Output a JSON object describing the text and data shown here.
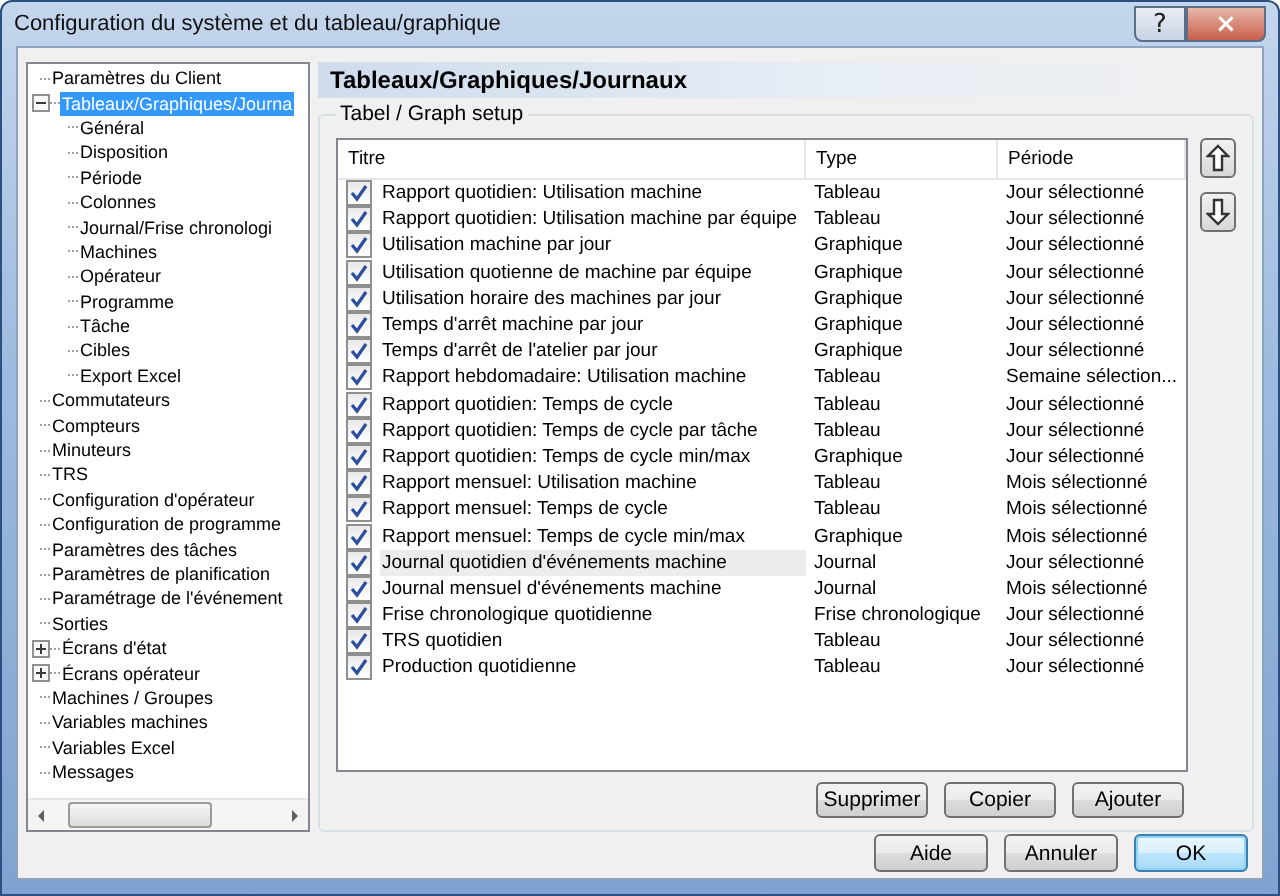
{
  "window": {
    "title": "Configuration du système et du tableau/graphique",
    "help_button": "?",
    "close_button": "×"
  },
  "tree": [
    {
      "label": "Paramètres du Client",
      "selected": false
    },
    {
      "label": "Tableaux/Graphiques/Journa",
      "selected": true,
      "expanded": true,
      "children": [
        {
          "label": "Général",
          "selected": false
        },
        {
          "label": "Disposition",
          "selected": false
        },
        {
          "label": "Période",
          "selected": false
        },
        {
          "label": "Colonnes",
          "selected": false
        },
        {
          "label": "Journal/Frise chronologi",
          "selected": false
        },
        {
          "label": "Machines",
          "selected": false
        },
        {
          "label": "Opérateur",
          "selected": false
        },
        {
          "label": "Programme",
          "selected": false
        },
        {
          "label": "Tâche",
          "selected": false
        },
        {
          "label": "Cibles",
          "selected": false
        },
        {
          "label": "Export Excel",
          "selected": false
        }
      ]
    },
    {
      "label": "Commutateurs",
      "selected": false
    },
    {
      "label": "Compteurs",
      "selected": false
    },
    {
      "label": "Minuteurs",
      "selected": false
    },
    {
      "label": "TRS",
      "selected": false
    },
    {
      "label": "Configuration d'opérateur",
      "selected": false
    },
    {
      "label": "Configuration de programme",
      "selected": false
    },
    {
      "label": "Paramètres des tâches",
      "selected": false
    },
    {
      "label": "Paramètres de planification",
      "selected": false
    },
    {
      "label": "Paramétrage de l'événement",
      "selected": false
    },
    {
      "label": "Sorties",
      "selected": false
    },
    {
      "label": "Écrans d'état",
      "selected": false,
      "expanded": false
    },
    {
      "label": "Écrans opérateur",
      "selected": false,
      "expanded": false
    },
    {
      "label": "Machines / Groupes",
      "selected": false
    },
    {
      "label": "Variables machines",
      "selected": false
    },
    {
      "label": "Variables Excel",
      "selected": false
    },
    {
      "label": "Messages",
      "selected": false
    }
  ],
  "panel": {
    "title": "Tableaux/Graphiques/Journaux",
    "group_label": "Tabel / Graph setup"
  },
  "table": {
    "columns": [
      "Titre",
      "Type",
      "Période"
    ],
    "rows": [
      {
        "title": "Rapport quotidien: Utilisation machine",
        "type": "Tableau",
        "period": "Jour sélectionné",
        "checked": true,
        "selected": false
      },
      {
        "title": "Rapport quotidien: Utilisation machine par équipe",
        "type": "Tableau",
        "period": "Jour sélectionné",
        "checked": true,
        "selected": false
      },
      {
        "title": "Utilisation machine par jour",
        "type": "Graphique",
        "period": "Jour sélectionné",
        "checked": true,
        "selected": false
      },
      {
        "title": "Utilisation quotienne de machine par équipe",
        "type": "Graphique",
        "period": "Jour sélectionné",
        "checked": true,
        "selected": false
      },
      {
        "title": "Utilisation horaire des machines par jour",
        "type": "Graphique",
        "period": "Jour sélectionné",
        "checked": true,
        "selected": false
      },
      {
        "title": "Temps d'arrêt machine par jour",
        "type": "Graphique",
        "period": "Jour sélectionné",
        "checked": true,
        "selected": false
      },
      {
        "title": "Temps d'arrêt de l'atelier par jour",
        "type": "Graphique",
        "period": "Jour sélectionné",
        "checked": true,
        "selected": false
      },
      {
        "title": "Rapport hebdomadaire: Utilisation machine",
        "type": "Tableau",
        "period": "Semaine sélection...",
        "checked": true,
        "selected": false
      },
      {
        "title": "Rapport quotidien: Temps de cycle",
        "type": "Tableau",
        "period": "Jour sélectionné",
        "checked": true,
        "selected": false
      },
      {
        "title": "Rapport quotidien: Temps de cycle par tâche",
        "type": "Tableau",
        "period": "Jour sélectionné",
        "checked": true,
        "selected": false
      },
      {
        "title": "Rapport quotidien: Temps de cycle min/max",
        "type": "Graphique",
        "period": "Jour sélectionné",
        "checked": true,
        "selected": false
      },
      {
        "title": "Rapport mensuel: Utilisation machine",
        "type": "Tableau",
        "period": "Mois sélectionné",
        "checked": true,
        "selected": false
      },
      {
        "title": "Rapport mensuel: Temps de cycle",
        "type": "Tableau",
        "period": "Mois sélectionné",
        "checked": true,
        "selected": false
      },
      {
        "title": "Rapport mensuel: Temps de cycle min/max",
        "type": "Graphique",
        "period": "Mois sélectionné",
        "checked": true,
        "selected": false
      },
      {
        "title": "Journal quotidien d'événements machine",
        "type": "Journal",
        "period": "Jour sélectionné",
        "checked": true,
        "selected": true
      },
      {
        "title": "Journal mensuel d'événements machine",
        "type": "Journal",
        "period": "Mois sélectionné",
        "checked": true,
        "selected": false
      },
      {
        "title": "Frise chronologique quotidienne",
        "type": "Frise chronologique",
        "period": "Jour sélectionné",
        "checked": true,
        "selected": false
      },
      {
        "title": "TRS quotidien",
        "type": "Tableau",
        "period": "Jour sélectionné",
        "checked": true,
        "selected": false
      },
      {
        "title": "Production quotidienne",
        "type": "Tableau",
        "period": "Jour sélectionné",
        "checked": true,
        "selected": false
      }
    ]
  },
  "table_buttons": [
    "Supprimer",
    "Copier",
    "Ajouter"
  ],
  "dialog_buttons": [
    {
      "label": "Aide",
      "default": false
    },
    {
      "label": "Annuler",
      "default": false
    },
    {
      "label": "OK",
      "default": true
    }
  ]
}
